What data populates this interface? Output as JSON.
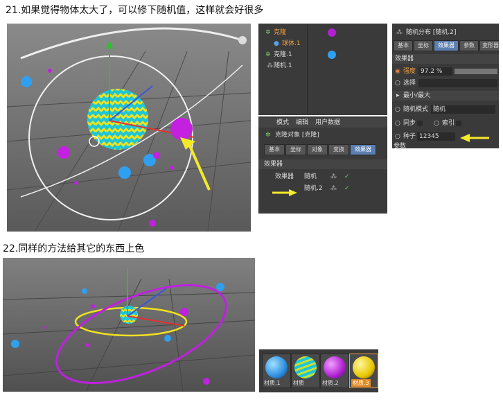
{
  "step21": {
    "caption": "21.如果觉得物体太大了，可以修下随机值，这样就会好很多"
  },
  "step22": {
    "caption": "22.同样的方法给其它的东西上色"
  },
  "object_manager": {
    "items": [
      {
        "label": "克隆"
      },
      {
        "label": "球体.1"
      },
      {
        "label": "克隆.1"
      },
      {
        "label": "随机.1"
      }
    ]
  },
  "clone_attr": {
    "menu": [
      "模式",
      "编辑",
      "用户数据"
    ],
    "title": "克隆对象 [克隆]",
    "tabs": [
      "基本",
      "坐标",
      "对象",
      "变换",
      "效果器"
    ],
    "section": "效果器",
    "field_label": "效果器",
    "effectors": [
      "随机",
      "随机.2"
    ]
  },
  "random_attr": {
    "title": "随机分布 [随机.2]",
    "tabs": [
      "基本",
      "坐标",
      "效果器",
      "参数",
      "变形器"
    ],
    "section": "效果器",
    "strength_label": "强度",
    "strength_value": "97.2 %",
    "select_label": "选择",
    "minmax_label": "最小/最大",
    "mode_label": "随机模式",
    "mode_value": "随机",
    "sync_label": "同步",
    "index_label": "索引",
    "seed_label": "种子",
    "seed_value": "12345",
    "params_label": "参数"
  },
  "materials": [
    {
      "label": "材质.1",
      "color": "#2f8fe0"
    },
    {
      "label": "材质",
      "color": "#3fb8a0"
    },
    {
      "label": "材质.2",
      "color": "#b020d0"
    },
    {
      "label": "材质.3",
      "color": "#e8c800"
    }
  ],
  "colors": {
    "viewport": "#6b6b6b",
    "panel": "#3a3a3a",
    "active_tab": "#5b7fb0",
    "arrow": "#f5ea2a"
  }
}
